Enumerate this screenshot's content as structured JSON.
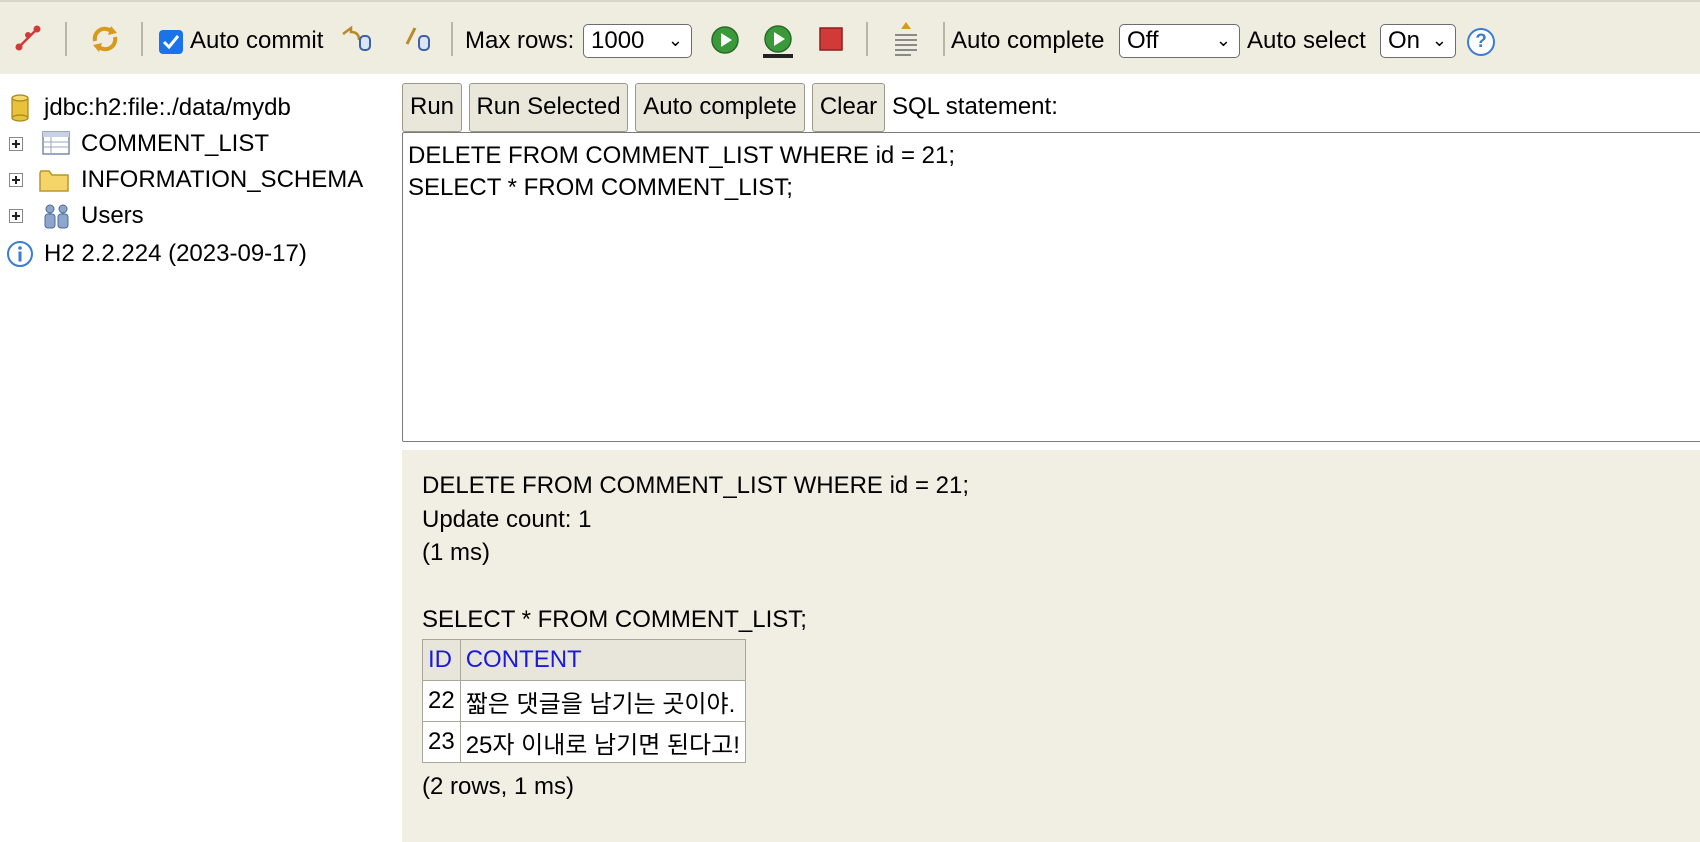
{
  "toolbar": {
    "auto_commit_label": "Auto commit",
    "auto_commit_checked": true,
    "max_rows_label": "Max rows:",
    "max_rows_value": "1000",
    "auto_complete_label": "Auto complete",
    "auto_complete_value": "Off",
    "auto_select_label": "Auto select",
    "auto_select_value": "On",
    "help_glyph": "?",
    "icons": [
      "disconnect-icon",
      "refresh-icon",
      "rollback-icon",
      "commit-icon",
      "run-icon",
      "run-selected-icon",
      "cancel-icon",
      "history-icon",
      "help-icon"
    ]
  },
  "tree": {
    "connection": "jdbc:h2:file:./data/mydb",
    "items": [
      {
        "label": "COMMENT_LIST",
        "icon": "table-icon"
      },
      {
        "label": "INFORMATION_SCHEMA",
        "icon": "folder-icon"
      },
      {
        "label": "Users",
        "icon": "users-icon"
      }
    ],
    "version": "H2 2.2.224 (2023-09-17)"
  },
  "query_bar": {
    "run_label": "Run",
    "run_selected_label": "Run Selected",
    "auto_complete_label": "Auto complete",
    "clear_label": "Clear",
    "sql_statement_label": "SQL statement:"
  },
  "editor": {
    "lines": [
      "DELETE FROM COMMENT_LIST WHERE id = 21;",
      "SELECT * FROM COMMENT_LIST;"
    ]
  },
  "result": {
    "statement1": "DELETE FROM COMMENT_LIST WHERE id = 21;",
    "update_count": "Update count: 1",
    "time1": "(1 ms)",
    "statement2": "SELECT * FROM COMMENT_LIST;",
    "columns": [
      "ID",
      "CONTENT"
    ],
    "rows": [
      [
        "22",
        "짧은 댓글을 남기는 곳이야."
      ],
      [
        "23",
        "25자 이내로 남기면 된다고!"
      ]
    ],
    "summary": "(2 rows, 1 ms)"
  },
  "colors": {
    "toolbar_bg": "#efede0",
    "result_bg": "#f1efe3",
    "header_link": "#1a1adc",
    "checkbox": "#1a73e8"
  }
}
